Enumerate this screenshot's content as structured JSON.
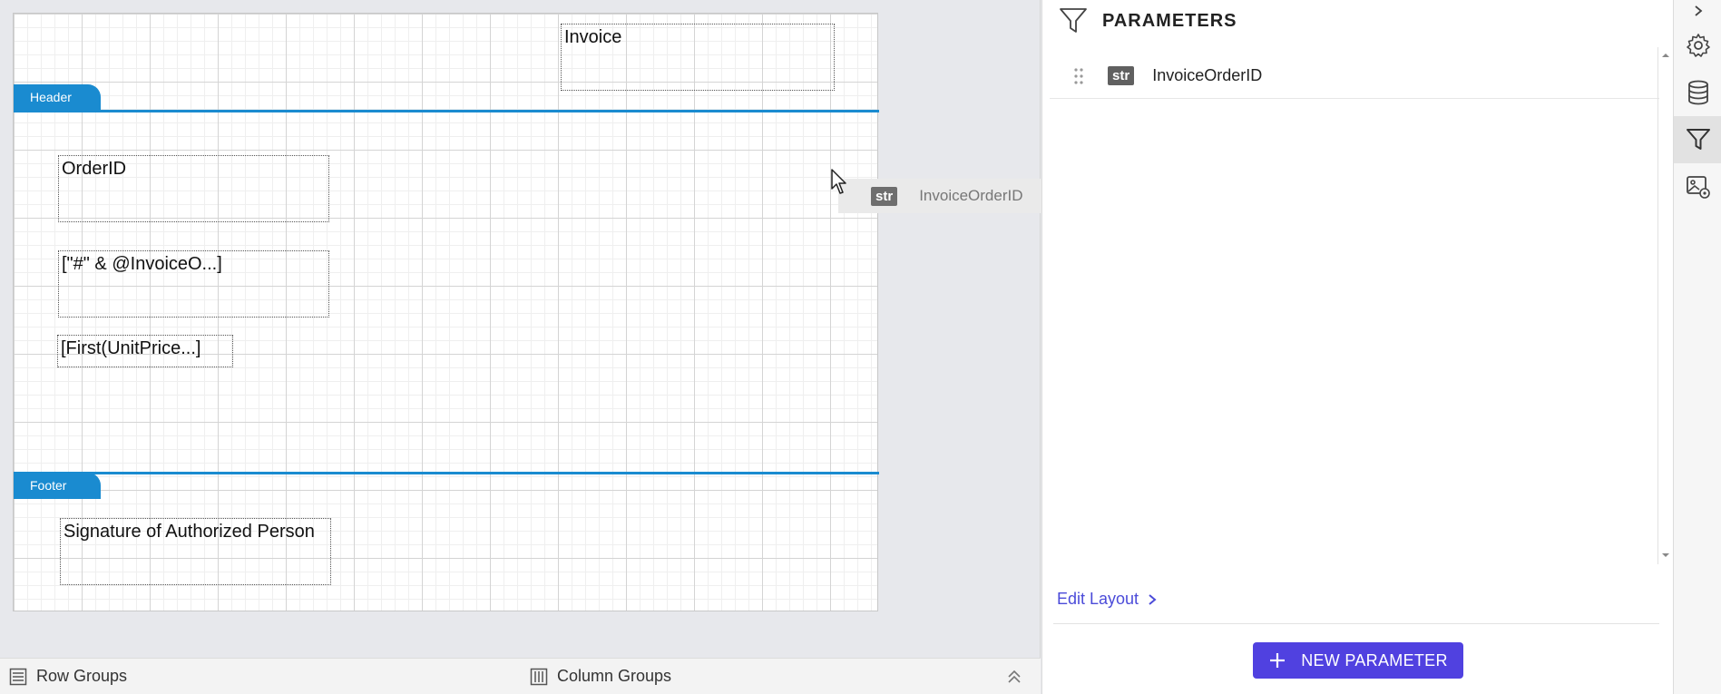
{
  "canvas": {
    "bands": {
      "header_label": "Header",
      "footer_label": "Footer"
    },
    "items": {
      "invoice_title": "Invoice",
      "order_id_label": "OrderID",
      "invoice_expr": "[\"#\" & @InvoiceO...]",
      "unit_price_expr": "[First(UnitPrice...]",
      "signature_label": "Signature of Authorized Person"
    },
    "drag_ghost": {
      "type_badge": "str",
      "name": "InvoiceOrderID"
    }
  },
  "group_bar": {
    "row_groups": "Row Groups",
    "column_groups": "Column Groups"
  },
  "parameters_panel": {
    "title": "PARAMETERS",
    "items": [
      {
        "type_badge": "str",
        "name": "InvoiceOrderID"
      }
    ],
    "edit_layout": "Edit Layout",
    "new_parameter_button": "NEW PARAMETER"
  },
  "icon_rail": {
    "icons": [
      "chevron-right-icon",
      "gear-icon",
      "database-icon",
      "filter-icon",
      "image-settings-icon"
    ],
    "active": "filter-icon"
  },
  "colors": {
    "accent": "#5041e0",
    "band": "#1a8bd0",
    "link": "#4b4bd9"
  }
}
